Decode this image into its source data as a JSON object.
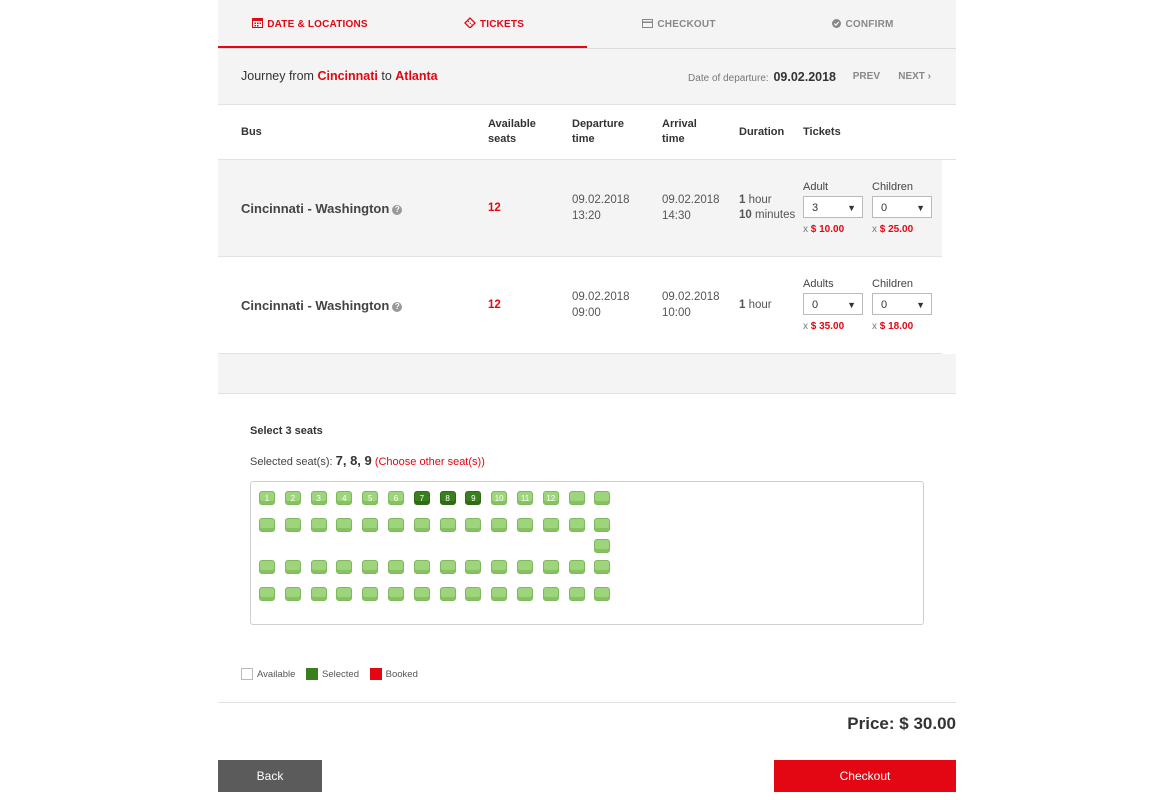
{
  "steps": [
    {
      "label": "DATE & LOCATIONS",
      "icon": "calendar-icon",
      "state": "active"
    },
    {
      "label": "TICKETS",
      "icon": "ticket-icon",
      "state": "active"
    },
    {
      "label": "CHECKOUT",
      "icon": "credit-card-icon",
      "state": "inactive"
    },
    {
      "label": "CONFIRM",
      "icon": "check-circle-icon",
      "state": "inactive"
    }
  ],
  "journey": {
    "prefix": "Journey from",
    "from": "Cincinnati",
    "to_word": "to",
    "to": "Atlanta",
    "date_label": "Date of departure:",
    "date_value": "09.02.2018",
    "prev": "PREV",
    "next": "NEXT ›"
  },
  "table": {
    "headers": {
      "bus": "Bus",
      "seats_1": "Available",
      "seats_2": "seats",
      "dep_1": "Departure",
      "dep_2": "time",
      "arr_1": "Arrival",
      "arr_2": "time",
      "duration": "Duration",
      "tickets": "Tickets"
    },
    "rows": [
      {
        "bus": "Cincinnati - Washington",
        "seats": "12",
        "dep_date": "09.02.2018",
        "dep_time": "13:20",
        "arr_date": "09.02.2018",
        "arr_time": "14:30",
        "dur_h": "1",
        "dur_h_unit": "hour",
        "dur_m": "10",
        "dur_m_unit": "minutes",
        "adult_label": "Adult",
        "adult_value": "3",
        "adult_price_x": "x",
        "adult_price": "$ 10.00",
        "child_label": "Children",
        "child_value": "0",
        "child_price_x": "x",
        "child_price": "$ 25.00"
      },
      {
        "bus": "Cincinnati - Washington",
        "seats": "12",
        "dep_date": "09.02.2018",
        "dep_time": "09:00",
        "arr_date": "09.02.2018",
        "arr_time": "10:00",
        "dur_h": "1",
        "dur_h_unit": "hour",
        "adult_label": "Adults",
        "adult_value": "0",
        "adult_price_x": "x",
        "adult_price": "$ 35.00",
        "child_label": "Children",
        "child_value": "0",
        "child_price_x": "x",
        "child_price": "$ 18.00"
      }
    ]
  },
  "seat_selection": {
    "heading": "Select 3 seats",
    "selected_prefix": "Selected seat(s):",
    "selected_values": "7, 8, 9",
    "choose_other": "(Choose other seat(s))",
    "row1_numbers": [
      "1",
      "2",
      "3",
      "4",
      "5",
      "6",
      "7",
      "8",
      "9",
      "10",
      "11",
      "12",
      "",
      ""
    ],
    "selected": [
      "7",
      "8",
      "9"
    ]
  },
  "legend": {
    "available": "Available",
    "selected": "Selected",
    "booked": "Booked"
  },
  "colors": {
    "accent": "#e30613",
    "seat_available": "#9ed47c",
    "seat_selected": "#3a7f1e",
    "booked": "#e30613"
  },
  "price": "Price: $ 30.00",
  "buttons": {
    "back": "Back",
    "checkout": "Checkout"
  }
}
